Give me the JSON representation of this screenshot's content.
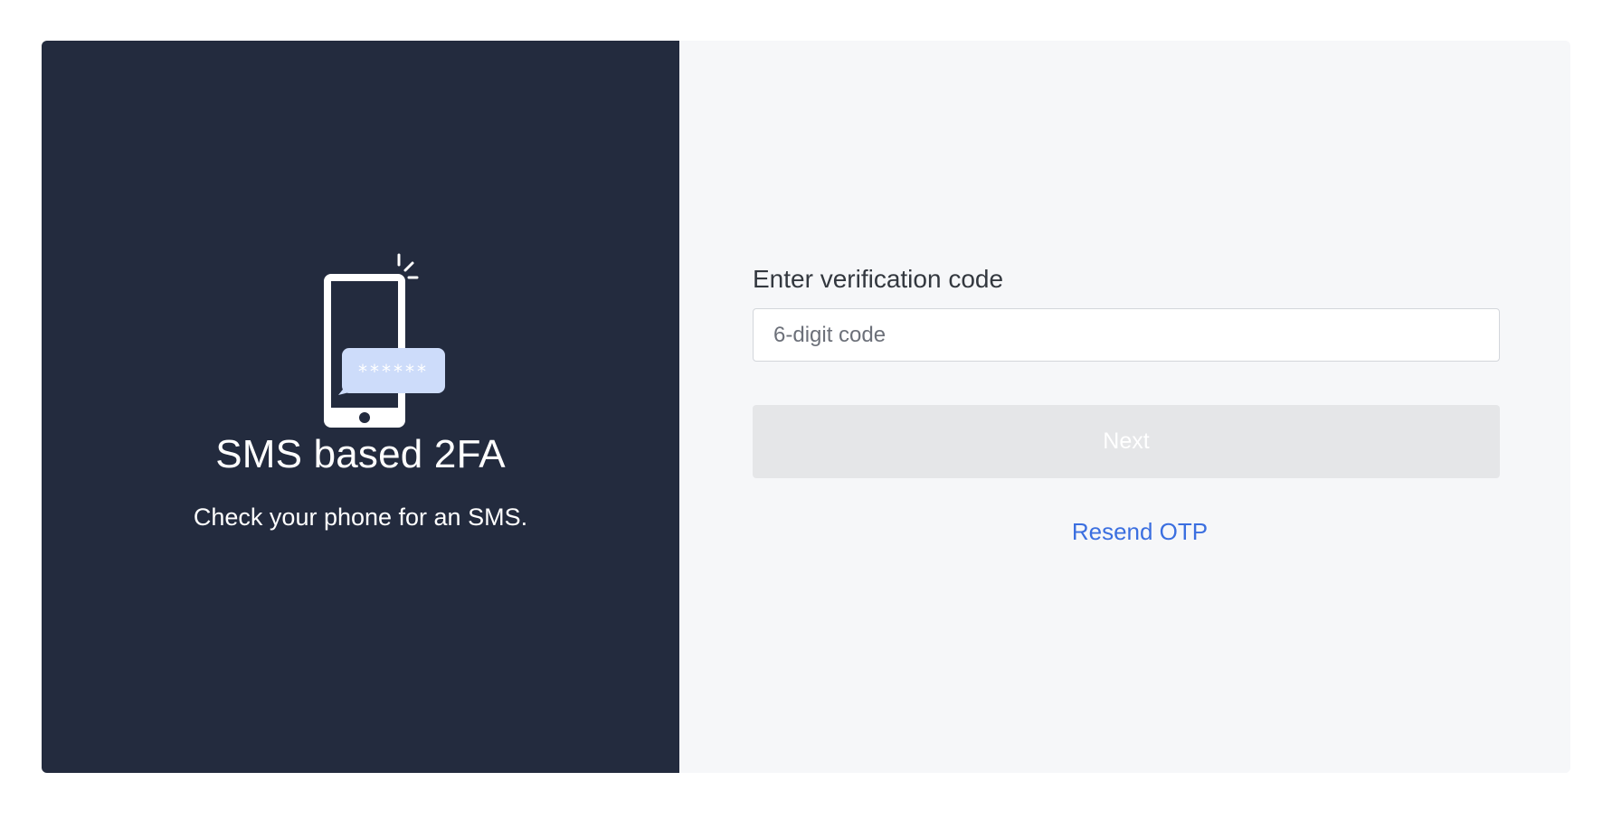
{
  "left": {
    "title": "SMS based 2FA",
    "subtitle": "Check your phone for an SMS.",
    "bubble_mask": "******",
    "icon": "phone-sms-icon"
  },
  "form": {
    "label": "Enter verification code",
    "placeholder": "6-digit code",
    "value": "",
    "next_label": "Next",
    "resend_label": "Resend OTP"
  },
  "colors": {
    "left_bg": "#232b3e",
    "right_bg": "#f6f7f9",
    "link": "#3b6fe0",
    "bubble": "#cddcfa",
    "button_disabled": "#e5e6e8"
  }
}
